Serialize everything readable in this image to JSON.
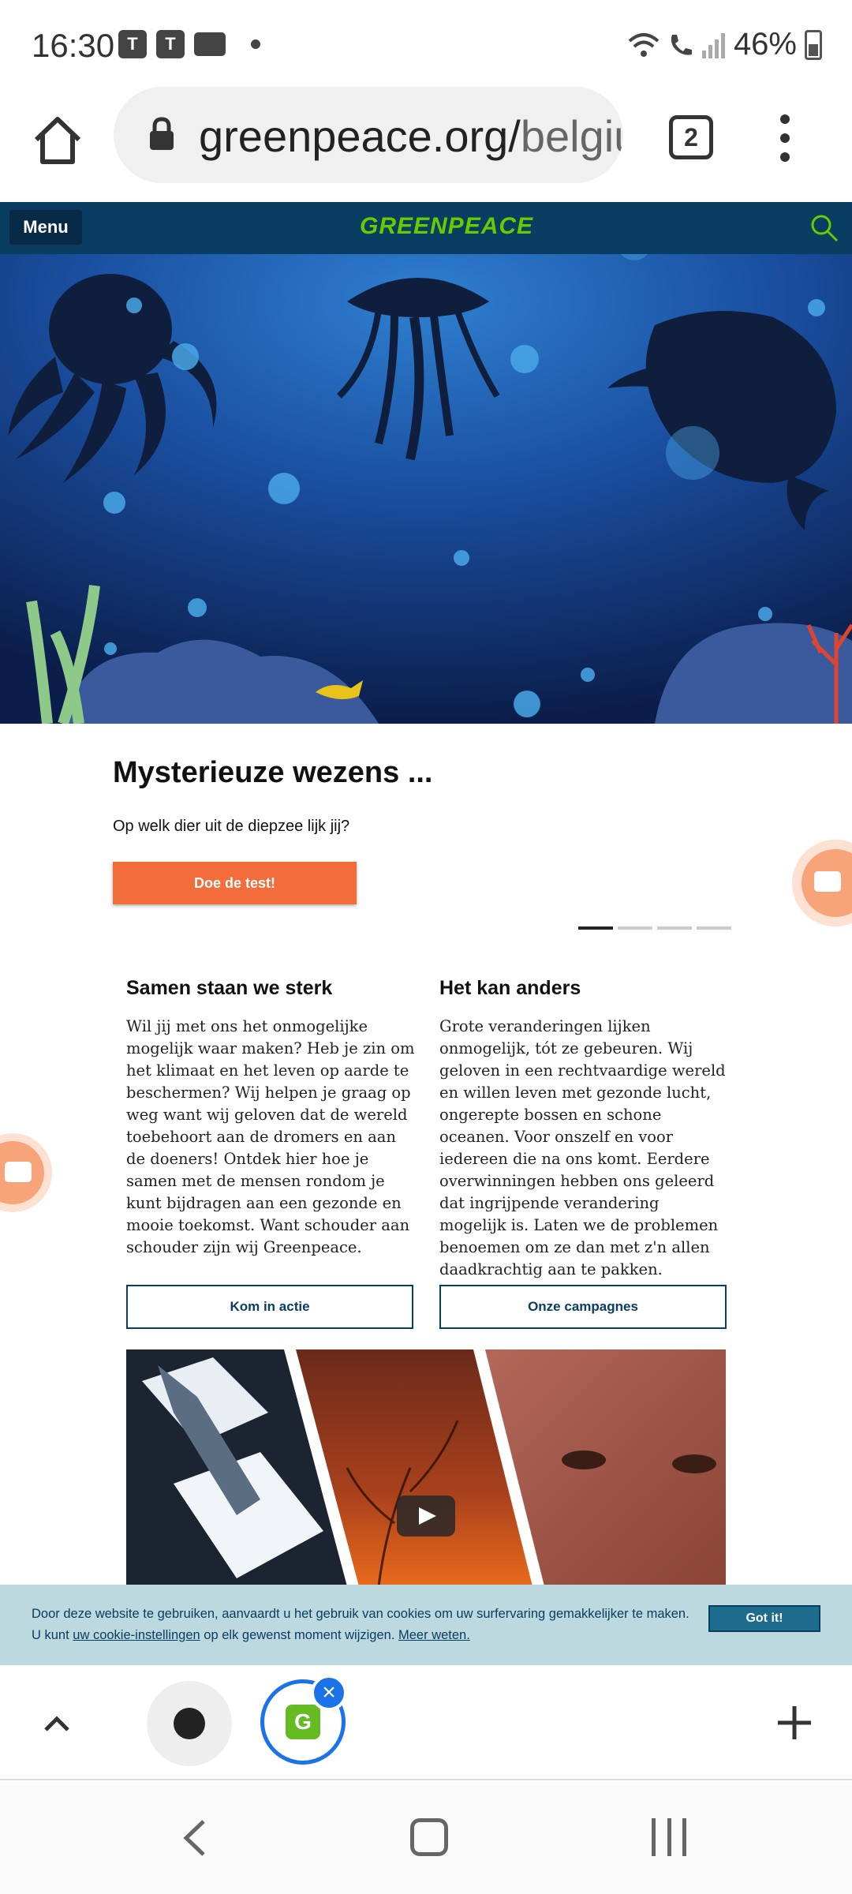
{
  "status_bar": {
    "time": "16:30",
    "battery": "46%",
    "teams_letter": "T"
  },
  "browser": {
    "url_main": "greenpeace.org/",
    "url_faded": "belgiu",
    "tab_count": "2"
  },
  "site_header": {
    "menu_label": "Menu",
    "logo": "GREENPEACE"
  },
  "carousel": {
    "title": "Mysterieuze wezens ...",
    "subtitle": "Op welk dier uit de diepzee lijk jij?",
    "cta_label": "Doe de test!",
    "slides": 4,
    "active_slide": 1
  },
  "columns": [
    {
      "heading": "Samen staan we sterk",
      "body": "Wil jij met ons het onmogelijke mogelijk waar maken? Heb je zin om het klimaat en het leven op aarde te beschermen? Wij helpen je graag op weg want wij geloven dat de wereld toebehoort aan de dromers en aan de doeners! Ontdek hier hoe je samen met de mensen rondom je kunt bijdragen aan een gezonde en mooie toekomst. Want schouder aan schouder zijn wij Greenpeace.",
      "button": "Kom in actie"
    },
    {
      "heading": "Het kan anders",
      "body": "Grote veranderingen lijken onmogelijk, tót ze gebeuren. Wij geloven in een rechtvaardige wereld en willen leven met gezonde lucht, ongerepte bossen en schone oceanen. Voor onszelf en voor iedereen die na ons komt. Eerdere overwinningen hebben ons geleerd dat ingrijpende verandering mogelijk is. Laten we de problemen benoemen om ze dan met z'n allen daadkrachtig aan te pakken.",
      "button": "Onze campagnes"
    }
  ],
  "cookie_bar": {
    "line1": "Door deze website te gebruiken, aanvaardt u het gebruik van cookies om uw surfervaring gemakkelijker te maken.",
    "line2_prefix": "U kunt ",
    "settings_link": "uw cookie-instellingen",
    "line2_middle": " op elk gewenst moment wijzigen. ",
    "more_link": "Meer weten.",
    "button": "Got it!"
  },
  "tab_strip": {
    "active_tab_letter": "G"
  },
  "colors": {
    "header_bg": "#0a3d62",
    "logo_green": "#66cc00",
    "cta_orange": "#f36d3a",
    "cookie_bg": "#bcd9df",
    "accent_blue": "#1a73e8"
  }
}
